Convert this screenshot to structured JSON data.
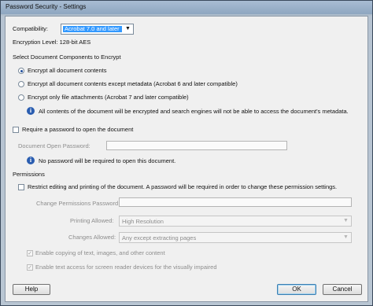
{
  "window": {
    "title": "Password Security - Settings"
  },
  "compatibility": {
    "label": "Compatibility:",
    "value": "Acrobat 7.0 and later",
    "encryption_level": "Encryption  Level:  128-bit AES"
  },
  "components": {
    "heading": "Select Document Components to Encrypt",
    "options": [
      {
        "label": "Encrypt all document contents",
        "selected": true
      },
      {
        "label": "Encrypt all document contents except metadata (Acrobat 6 and later compatible)",
        "selected": false
      },
      {
        "label": "Encrypt only file attachments (Acrobat 7 and later compatible)",
        "selected": false
      }
    ],
    "info": "All contents of the document will be encrypted and search engines will not be able to access the document's metadata."
  },
  "open_password": {
    "checkbox_label": "Require a password to open the document",
    "field_label": "Document Open Password:",
    "field_value": "",
    "info": "No password will be required to open this document."
  },
  "permissions": {
    "heading": "Permissions",
    "restrict_label": "Restrict editing and printing of the document. A password will be required in order to change these permission settings.",
    "change_password_label": "Change Permissions Password:",
    "change_password_value": "",
    "printing_label": "Printing Allowed:",
    "printing_value": "High Resolution",
    "changes_label": "Changes Allowed:",
    "changes_value": "Any except extracting pages",
    "copy_label": "Enable copying of text, images, and other content",
    "screen_reader_label": "Enable text access for screen reader devices for the visually impaired"
  },
  "buttons": {
    "help": "Help",
    "ok": "OK",
    "cancel": "Cancel"
  },
  "icons": {
    "info": "info-icon",
    "dropdown": "chevron-down-icon",
    "check": "checkmark-icon"
  },
  "colors": {
    "selection": "#3399ff",
    "info_icon": "#2a5db0"
  }
}
